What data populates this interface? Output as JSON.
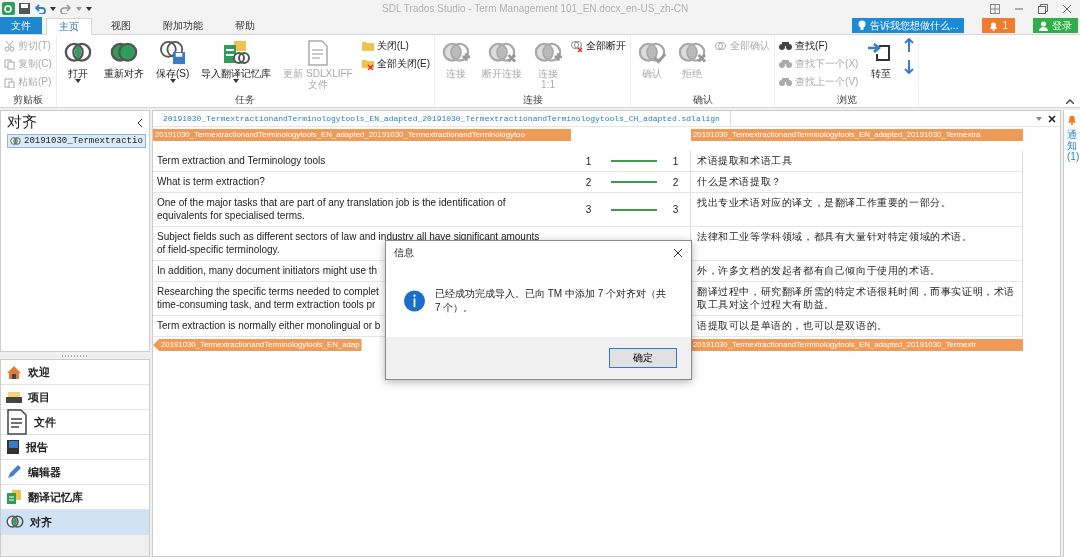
{
  "window": {
    "title": "SDL Trados Studio - Term Management 101_EN.docx_en-US_zh-CN"
  },
  "tabs": [
    {
      "label": "文件",
      "kind": "file",
      "selected": false
    },
    {
      "label": "主页",
      "kind": "tab",
      "selected": true
    },
    {
      "label": "视图",
      "kind": "tab",
      "selected": false
    },
    {
      "label": "附加功能",
      "kind": "tab",
      "selected": false
    },
    {
      "label": "帮助",
      "kind": "tab",
      "selected": false
    }
  ],
  "tell_me": {
    "label": "告诉我您想做什么..."
  },
  "notifications": {
    "count": "1"
  },
  "sign_in": {
    "label": "登录"
  },
  "ribbon": [
    {
      "label": "剪贴板",
      "items": [
        {
          "kind": "stack",
          "entries": [
            {
              "label": "剪切(T)",
              "disabled": true
            },
            {
              "label": "复制(C)",
              "disabled": true
            },
            {
              "label": "粘贴(P)",
              "disabled": true
            }
          ]
        }
      ]
    },
    {
      "label": "任务",
      "items": [
        {
          "kind": "large",
          "lines": [
            "打开"
          ],
          "disabled": false,
          "dropdown": true
        },
        {
          "kind": "large",
          "lines": [
            "重新对齐"
          ],
          "disabled": false,
          "dropdown": false
        },
        {
          "kind": "large",
          "lines": [
            "保存(S)"
          ],
          "disabled": false,
          "dropdown": true
        },
        {
          "kind": "large",
          "lines": [
            "导入翻译记忆库"
          ],
          "disabled": false,
          "dropdown": true
        },
        {
          "kind": "large",
          "lines": [
            "更新 SDLXLIFF",
            "文件"
          ],
          "disabled": true,
          "dropdown": false
        },
        {
          "kind": "stack",
          "entries": [
            {
              "label": "关闭(L)",
              "disabled": false
            },
            {
              "label": "全部关闭(E)",
              "disabled": false
            }
          ]
        }
      ]
    },
    {
      "label": "连接",
      "items": [
        {
          "kind": "large",
          "lines": [
            "连接"
          ],
          "disabled": true,
          "dropdown": false
        },
        {
          "kind": "large",
          "lines": [
            "断开连接"
          ],
          "disabled": true,
          "dropdown": false
        },
        {
          "kind": "large",
          "lines": [
            "连接",
            "1:1"
          ],
          "disabled": true,
          "dropdown": false
        },
        {
          "kind": "stack",
          "entries": [
            {
              "label": "全部断开",
              "disabled": false
            }
          ]
        }
      ]
    },
    {
      "label": "确认",
      "items": [
        {
          "kind": "large",
          "lines": [
            "确认"
          ],
          "disabled": true,
          "dropdown": false
        },
        {
          "kind": "large",
          "lines": [
            "拒绝"
          ],
          "disabled": true,
          "dropdown": false
        },
        {
          "kind": "stack",
          "entries": [
            {
              "label": "全部确认",
              "disabled": true
            }
          ]
        }
      ]
    },
    {
      "label": "浏览",
      "items": [
        {
          "kind": "stack",
          "entries": [
            {
              "label": "查找(F)",
              "disabled": false
            },
            {
              "label": "查找下一个(X)",
              "disabled": true
            },
            {
              "label": "查找上一个(V)",
              "disabled": true
            }
          ]
        },
        {
          "kind": "large",
          "lines": [
            "转至"
          ],
          "disabled": false,
          "dropdown": false
        },
        {
          "kind": "arrows"
        }
      ]
    }
  ],
  "left_panel": {
    "title": "对齐",
    "tree": [
      {
        "label": "20191030_Termextractio",
        "selected": true
      }
    ]
  },
  "nav": [
    {
      "label": "欢迎",
      "selected": false
    },
    {
      "label": "项目",
      "selected": false
    },
    {
      "label": "文件",
      "selected": false
    },
    {
      "label": "报告",
      "selected": false
    },
    {
      "label": "编辑器",
      "selected": false
    },
    {
      "label": "翻译记忆库",
      "selected": false
    },
    {
      "label": "对齐",
      "selected": true
    }
  ],
  "document_tab": {
    "label": "20191030_TermextractionandTerminologytools_EN_adapted_20191030_TermextractionandTerminologytools_CH_adapted.sdlalign"
  },
  "alignment": {
    "source_header": "20191030_TermextractionandTerminologytools_EN_adapted_20191030_TermextractionandTerminologytoo",
    "target_header": "20191030_TermextractionandTerminologytools_EN_adapted_20191030_Termextra",
    "source_footer": "20191030_TermextractionandTerminologytools_EN_adap",
    "target_footer": "20191030_TermextractionandTerminologytools_EN_adapted_20191030_Termextr",
    "rows": [
      {
        "source": [
          "Term extraction and Terminology tools"
        ],
        "left_number": "1",
        "right_number": "1",
        "target": [
          "术语提取和术语工具"
        ]
      },
      {
        "source": [
          "What is term extraction?"
        ],
        "left_number": "2",
        "right_number": "2",
        "target": [
          "什么是术语提取？"
        ]
      },
      {
        "source": [
          "One of the major tasks that are part of any translation job is the identification of",
          "equivalents for specialised terms."
        ],
        "left_number": "3",
        "right_number": "3",
        "target": [
          "找出专业术语对应的译文，是翻译工作重要的一部分。"
        ]
      },
      {
        "source": [
          "Subject fields such as different sectors of law and industry all have significant amounts",
          "of field-specific terminology."
        ],
        "target": [
          "法律和工业等学科领域，都具有大量针对特定领域的术语。"
        ]
      },
      {
        "source": [
          "In addition, many document initiators might use th"
        ],
        "target": [
          "外，许多文档的发起者都有自己倾向于使用的术语。"
        ]
      },
      {
        "source": [
          "Researching the specific terms needed to complet",
          "time-consuming task, and term extraction tools pr"
        ],
        "target": [
          "翻译过程中，研究翻译所需的特定术语很耗时间，而事实证明，术语",
          "取工具对这个过程大有助益。"
        ]
      },
      {
        "source": [
          "Term extraction is normally either monolingual or b"
        ],
        "target": [
          "语提取可以是单语的，也可以是双语的。"
        ]
      }
    ]
  },
  "side_tab": {
    "label": "通知 (1)"
  },
  "dialog": {
    "title": "信息",
    "message": "已经成功完成导入。已向 TM 中添加 7 个对齐对（共 7 个）。",
    "button": "确定"
  }
}
